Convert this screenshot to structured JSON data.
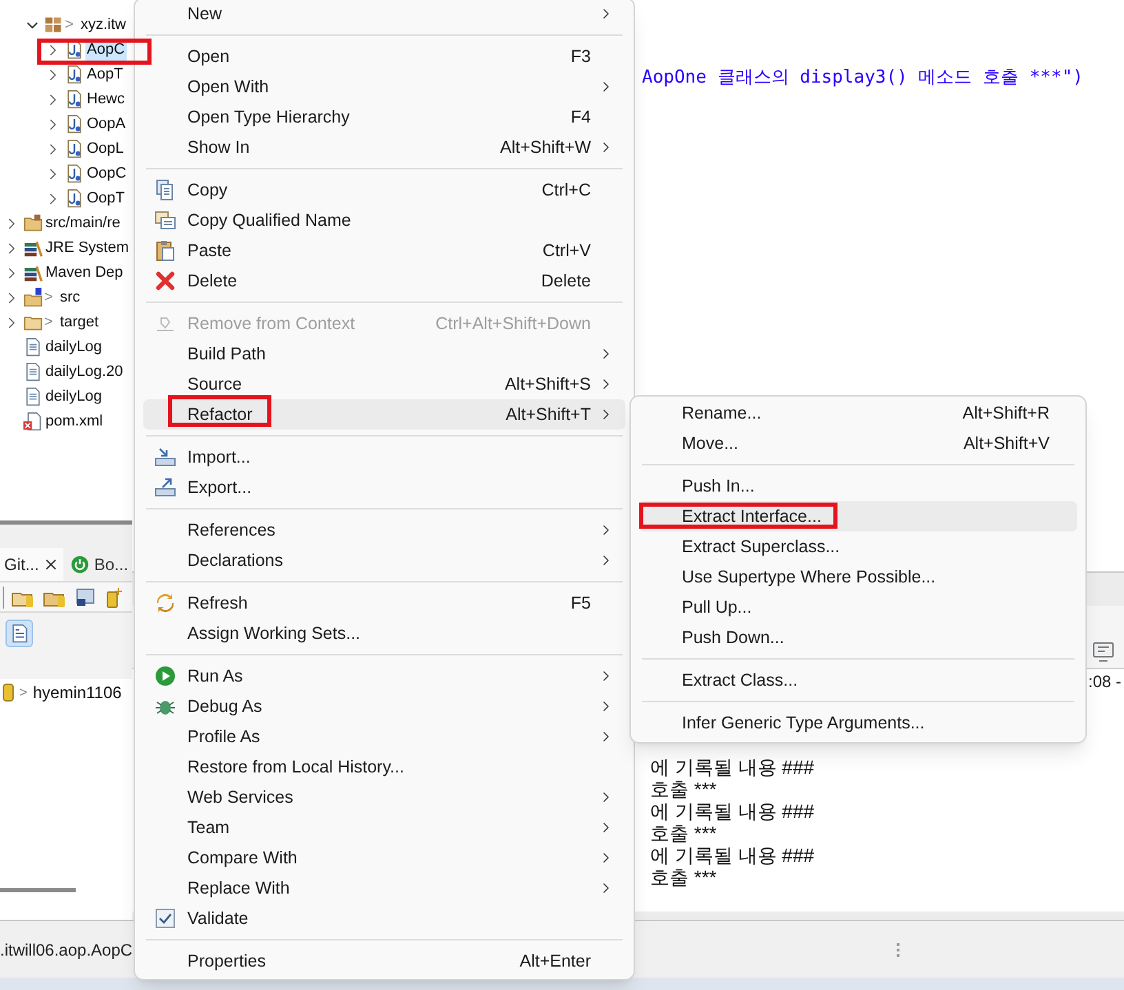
{
  "project_explorer": {
    "items": [
      {
        "label": "xyz.itw",
        "git_marker": ">",
        "kind": "package",
        "expanded": true,
        "selected": false,
        "children": [
          {
            "label": "AopC",
            "kind": "java",
            "expanded": false,
            "selected": true
          },
          {
            "label": "AopT",
            "kind": "java",
            "expanded": false,
            "selected": false
          },
          {
            "label": "Hewc",
            "kind": "java",
            "expanded": false,
            "selected": false
          },
          {
            "label": "OopA",
            "kind": "java",
            "expanded": false,
            "selected": false
          },
          {
            "label": "OopL",
            "kind": "java",
            "expanded": false,
            "selected": false
          },
          {
            "label": "OopC",
            "kind": "java",
            "expanded": false,
            "selected": false
          },
          {
            "label": "OopT",
            "kind": "java",
            "expanded": false,
            "selected": false
          }
        ]
      }
    ],
    "root_items": [
      {
        "label": "src/main/re",
        "kind": "source-folder",
        "expanded": false,
        "selected": false
      },
      {
        "label": "JRE System",
        "kind": "library",
        "expanded": false,
        "selected": false
      },
      {
        "label": "Maven Dep",
        "kind": "library",
        "expanded": false,
        "selected": false
      },
      {
        "label": "src",
        "git_marker": ">",
        "kind": "git-folder",
        "expanded": false,
        "selected": false
      },
      {
        "label": "target",
        "git_marker": ">",
        "kind": "folder",
        "expanded": false,
        "selected": false
      },
      {
        "label": "dailyLog",
        "kind": "file",
        "selected": false
      },
      {
        "label": "dailyLog.20",
        "kind": "file",
        "selected": false
      },
      {
        "label": "deilyLog",
        "kind": "file",
        "selected": false
      },
      {
        "label": "pom.xml",
        "kind": "xml",
        "selected": false
      }
    ]
  },
  "editor": {
    "code_line": "AopOne 클래스의 display3() 메소드 호출 ***\")"
  },
  "git_panel": {
    "tabs": [
      {
        "label": "Git...",
        "selected": true
      },
      {
        "label": "Bo...",
        "selected": false
      }
    ],
    "repository": {
      "label": "hyemin1106",
      "git_marker": ">"
    }
  },
  "console": {
    "header": ":08 -",
    "lines": [
      "에 기록될 내용 ###",
      "호출 ***",
      "에 기록될 내용 ###",
      "호출 ***",
      "에 기록될 내용 ###",
      "호출 ***"
    ]
  },
  "status_bar": {
    "text": ".itwill06.aop.AopC"
  },
  "context_menu": {
    "items": [
      {
        "kind": "item",
        "label": "New",
        "submenu": true,
        "selected": false,
        "disabled": false
      },
      {
        "kind": "separator"
      },
      {
        "kind": "item",
        "label": "Open",
        "shortcut": "F3",
        "submenu": false,
        "selected": false,
        "disabled": false
      },
      {
        "kind": "item",
        "label": "Open With",
        "submenu": true,
        "selected": false,
        "disabled": false
      },
      {
        "kind": "item",
        "label": "Open Type Hierarchy",
        "shortcut": "F4",
        "submenu": false,
        "selected": false,
        "disabled": false
      },
      {
        "kind": "item",
        "label": "Show In",
        "shortcut": "Alt+Shift+W",
        "submenu": true,
        "selected": false,
        "disabled": false
      },
      {
        "kind": "separator"
      },
      {
        "kind": "item",
        "label": "Copy",
        "shortcut": "Ctrl+C",
        "submenu": false,
        "selected": false,
        "disabled": false
      },
      {
        "kind": "item",
        "label": "Copy Qualified Name",
        "submenu": false,
        "selected": false,
        "disabled": false
      },
      {
        "kind": "item",
        "label": "Paste",
        "shortcut": "Ctrl+V",
        "submenu": false,
        "selected": false,
        "disabled": false
      },
      {
        "kind": "item",
        "label": "Delete",
        "shortcut": "Delete",
        "submenu": false,
        "selected": false,
        "disabled": false
      },
      {
        "kind": "separator"
      },
      {
        "kind": "item",
        "label": "Remove from Context",
        "shortcut": "Ctrl+Alt+Shift+Down",
        "submenu": false,
        "selected": false,
        "disabled": true
      },
      {
        "kind": "item",
        "label": "Build Path",
        "submenu": true,
        "selected": false,
        "disabled": false
      },
      {
        "kind": "item",
        "label": "Source",
        "shortcut": "Alt+Shift+S",
        "submenu": true,
        "selected": false,
        "disabled": false
      },
      {
        "kind": "item",
        "label": "Refactor",
        "shortcut": "Alt+Shift+T",
        "submenu": true,
        "selected": true,
        "disabled": false
      },
      {
        "kind": "separator"
      },
      {
        "kind": "item",
        "label": "Import...",
        "submenu": false,
        "selected": false,
        "disabled": false
      },
      {
        "kind": "item",
        "label": "Export...",
        "submenu": false,
        "selected": false,
        "disabled": false
      },
      {
        "kind": "separator"
      },
      {
        "kind": "item",
        "label": "References",
        "submenu": true,
        "selected": false,
        "disabled": false
      },
      {
        "kind": "item",
        "label": "Declarations",
        "submenu": true,
        "selected": false,
        "disabled": false
      },
      {
        "kind": "separator"
      },
      {
        "kind": "item",
        "label": "Refresh",
        "shortcut": "F5",
        "submenu": false,
        "selected": false,
        "disabled": false
      },
      {
        "kind": "item",
        "label": "Assign Working Sets...",
        "submenu": false,
        "selected": false,
        "disabled": false
      },
      {
        "kind": "separator"
      },
      {
        "kind": "item",
        "label": "Run As",
        "submenu": true,
        "selected": false,
        "disabled": false
      },
      {
        "kind": "item",
        "label": "Debug As",
        "submenu": true,
        "selected": false,
        "disabled": false
      },
      {
        "kind": "item",
        "label": "Profile As",
        "submenu": true,
        "selected": false,
        "disabled": false
      },
      {
        "kind": "item",
        "label": "Restore from Local History...",
        "submenu": false,
        "selected": false,
        "disabled": false
      },
      {
        "kind": "item",
        "label": "Web Services",
        "submenu": true,
        "selected": false,
        "disabled": false
      },
      {
        "kind": "item",
        "label": "Team",
        "submenu": true,
        "selected": false,
        "disabled": false
      },
      {
        "kind": "item",
        "label": "Compare With",
        "submenu": true,
        "selected": false,
        "disabled": false
      },
      {
        "kind": "item",
        "label": "Replace With",
        "submenu": true,
        "selected": false,
        "disabled": false
      },
      {
        "kind": "check",
        "label": "Validate",
        "checked": true,
        "submenu": false,
        "selected": false,
        "disabled": false
      },
      {
        "kind": "separator"
      },
      {
        "kind": "item",
        "label": "Properties",
        "shortcut": "Alt+Enter",
        "submenu": false,
        "selected": false,
        "disabled": false
      }
    ]
  },
  "refactor_submenu": {
    "items": [
      {
        "kind": "item",
        "label": "Rename...",
        "shortcut": "Alt+Shift+R",
        "selected": false
      },
      {
        "kind": "item",
        "label": "Move...",
        "shortcut": "Alt+Shift+V",
        "selected": false
      },
      {
        "kind": "separator"
      },
      {
        "kind": "item",
        "label": "Push In...",
        "selected": false
      },
      {
        "kind": "item",
        "label": "Extract Interface...",
        "selected": true
      },
      {
        "kind": "item",
        "label": "Extract Superclass...",
        "selected": false
      },
      {
        "kind": "item",
        "label": "Use Supertype Where Possible...",
        "selected": false
      },
      {
        "kind": "item",
        "label": "Pull Up...",
        "selected": false
      },
      {
        "kind": "item",
        "label": "Push Down...",
        "selected": false
      },
      {
        "kind": "separator"
      },
      {
        "kind": "item",
        "label": "Extract Class...",
        "selected": false
      },
      {
        "kind": "separator"
      },
      {
        "kind": "item",
        "label": "Infer Generic Type Arguments...",
        "selected": false
      }
    ]
  }
}
